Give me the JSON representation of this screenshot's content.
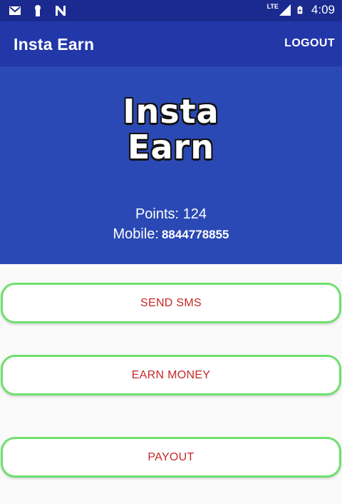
{
  "status_bar": {
    "time": "4:09",
    "network": "LTE",
    "icons": [
      "gmail-icon",
      "keyhole-icon",
      "n-notification-icon",
      "signal-icon",
      "battery-icon"
    ]
  },
  "app_bar": {
    "title": "Insta Earn",
    "logout_label": "LOGOUT"
  },
  "header": {
    "logo_line1": "Insta",
    "logo_line2": "Earn",
    "points_label": "Points: 124",
    "mobile_label": "Mobile:",
    "mobile_number": "8844778855"
  },
  "actions": {
    "send_sms": "SEND SMS",
    "earn_money": "EARN MONEY",
    "payout": "PAYOUT"
  },
  "colors": {
    "status_bar": "#1a2a8f",
    "app_bar": "#2237a8",
    "header": "#2a49b4",
    "button_border": "#6ee06e",
    "button_text": "#c62828"
  }
}
